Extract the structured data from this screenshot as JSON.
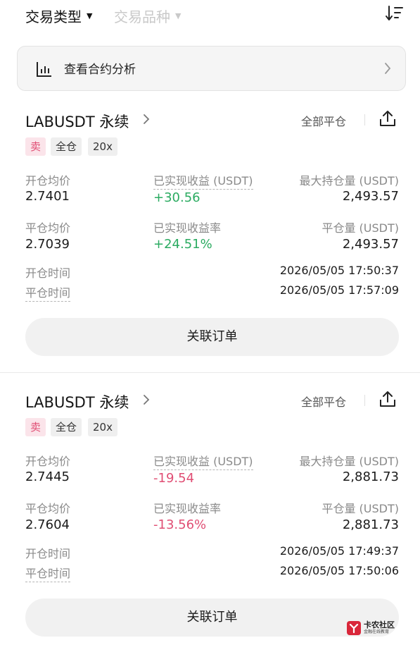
{
  "filters": {
    "trade_type": "交易类型",
    "instrument": "交易品种"
  },
  "analysis": {
    "label": "查看合约分析"
  },
  "labels": {
    "open_avg": "开仓均价",
    "realized_pnl": "已实现收益 (USDT)",
    "max_position": "最大持仓量 (USDT)",
    "close_avg": "平仓均价",
    "realized_rate": "已实现收益率",
    "close_volume": "平仓量 (USDT)",
    "open_time": "开仓时间",
    "close_time": "平仓时间",
    "close_all": "全部平仓",
    "related_orders": "关联订单"
  },
  "positions": [
    {
      "symbol": "LABUSDT 永续",
      "side": "卖",
      "margin_mode": "全仓",
      "leverage": "20x",
      "open_avg_price": "2.7401",
      "realized_pnl": "+30.56",
      "max_position": "2,493.57",
      "close_avg_price": "2.7039",
      "realized_rate": "+24.51%",
      "close_volume": "2,493.57",
      "open_time": "2026/05/05 17:50:37",
      "close_time": "2026/05/05 17:57:09"
    },
    {
      "symbol": "LABUSDT 永续",
      "side": "卖",
      "margin_mode": "全仓",
      "leverage": "20x",
      "open_avg_price": "2.7445",
      "realized_pnl": "-19.54",
      "max_position": "2,881.73",
      "close_avg_price": "2.7604",
      "realized_rate": "-13.56%",
      "close_volume": "2,881.73",
      "open_time": "2026/05/05 17:49:37",
      "close_time": "2026/05/05 17:50:06"
    }
  ],
  "watermark": {
    "title": "卡农社区",
    "subtitle": "金融在线教育"
  },
  "colors": {
    "profit": "#2bab61",
    "loss": "#e04e74",
    "sell_tag_bg": "#fbe4ea"
  },
  "icons": {
    "sort": "sort-icon",
    "chart": "bar-chart-icon",
    "chevron": "chevron-right-icon",
    "share": "share-icon"
  }
}
